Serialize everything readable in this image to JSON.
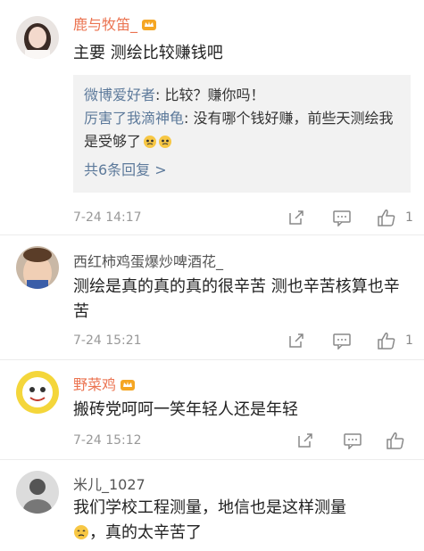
{
  "comments": [
    {
      "name": "鹿与牧笛_",
      "text": "主要 测绘比较赚钱吧",
      "replies": [
        {
          "name": "微博爱好者",
          "text": ": 比较？赚你吗！"
        },
        {
          "name": "厉害了我滴神龟",
          "text": ": 没有哪个钱好赚，前些天测绘我是受够了"
        }
      ],
      "more": "共6条回复 >",
      "time": "7-24 14:17",
      "likes": "1"
    },
    {
      "name": "西红柿鸡蛋爆炒啤酒花_",
      "text": "测绘是真的真的真的很辛苦 测也辛苦核算也辛苦",
      "time": "7-24 15:21",
      "likes": "1"
    },
    {
      "name": "野菜鸡",
      "text": "搬砖党呵呵一笑年轻人还是年轻",
      "time": "7-24 15:12",
      "likes": ""
    },
    {
      "name": "米儿_1027",
      "text": "我们学校工程测量，地信也是这样测量",
      "text2": "，真的太辛苦了"
    }
  ],
  "colors": {
    "vip_name": "#eb7350",
    "reply_name": "#5d7a9b",
    "reply_bg": "#f2f2f2"
  },
  "icons": [
    "crown-icon",
    "share-icon",
    "comment-icon",
    "like-icon",
    "emoji-icon"
  ]
}
